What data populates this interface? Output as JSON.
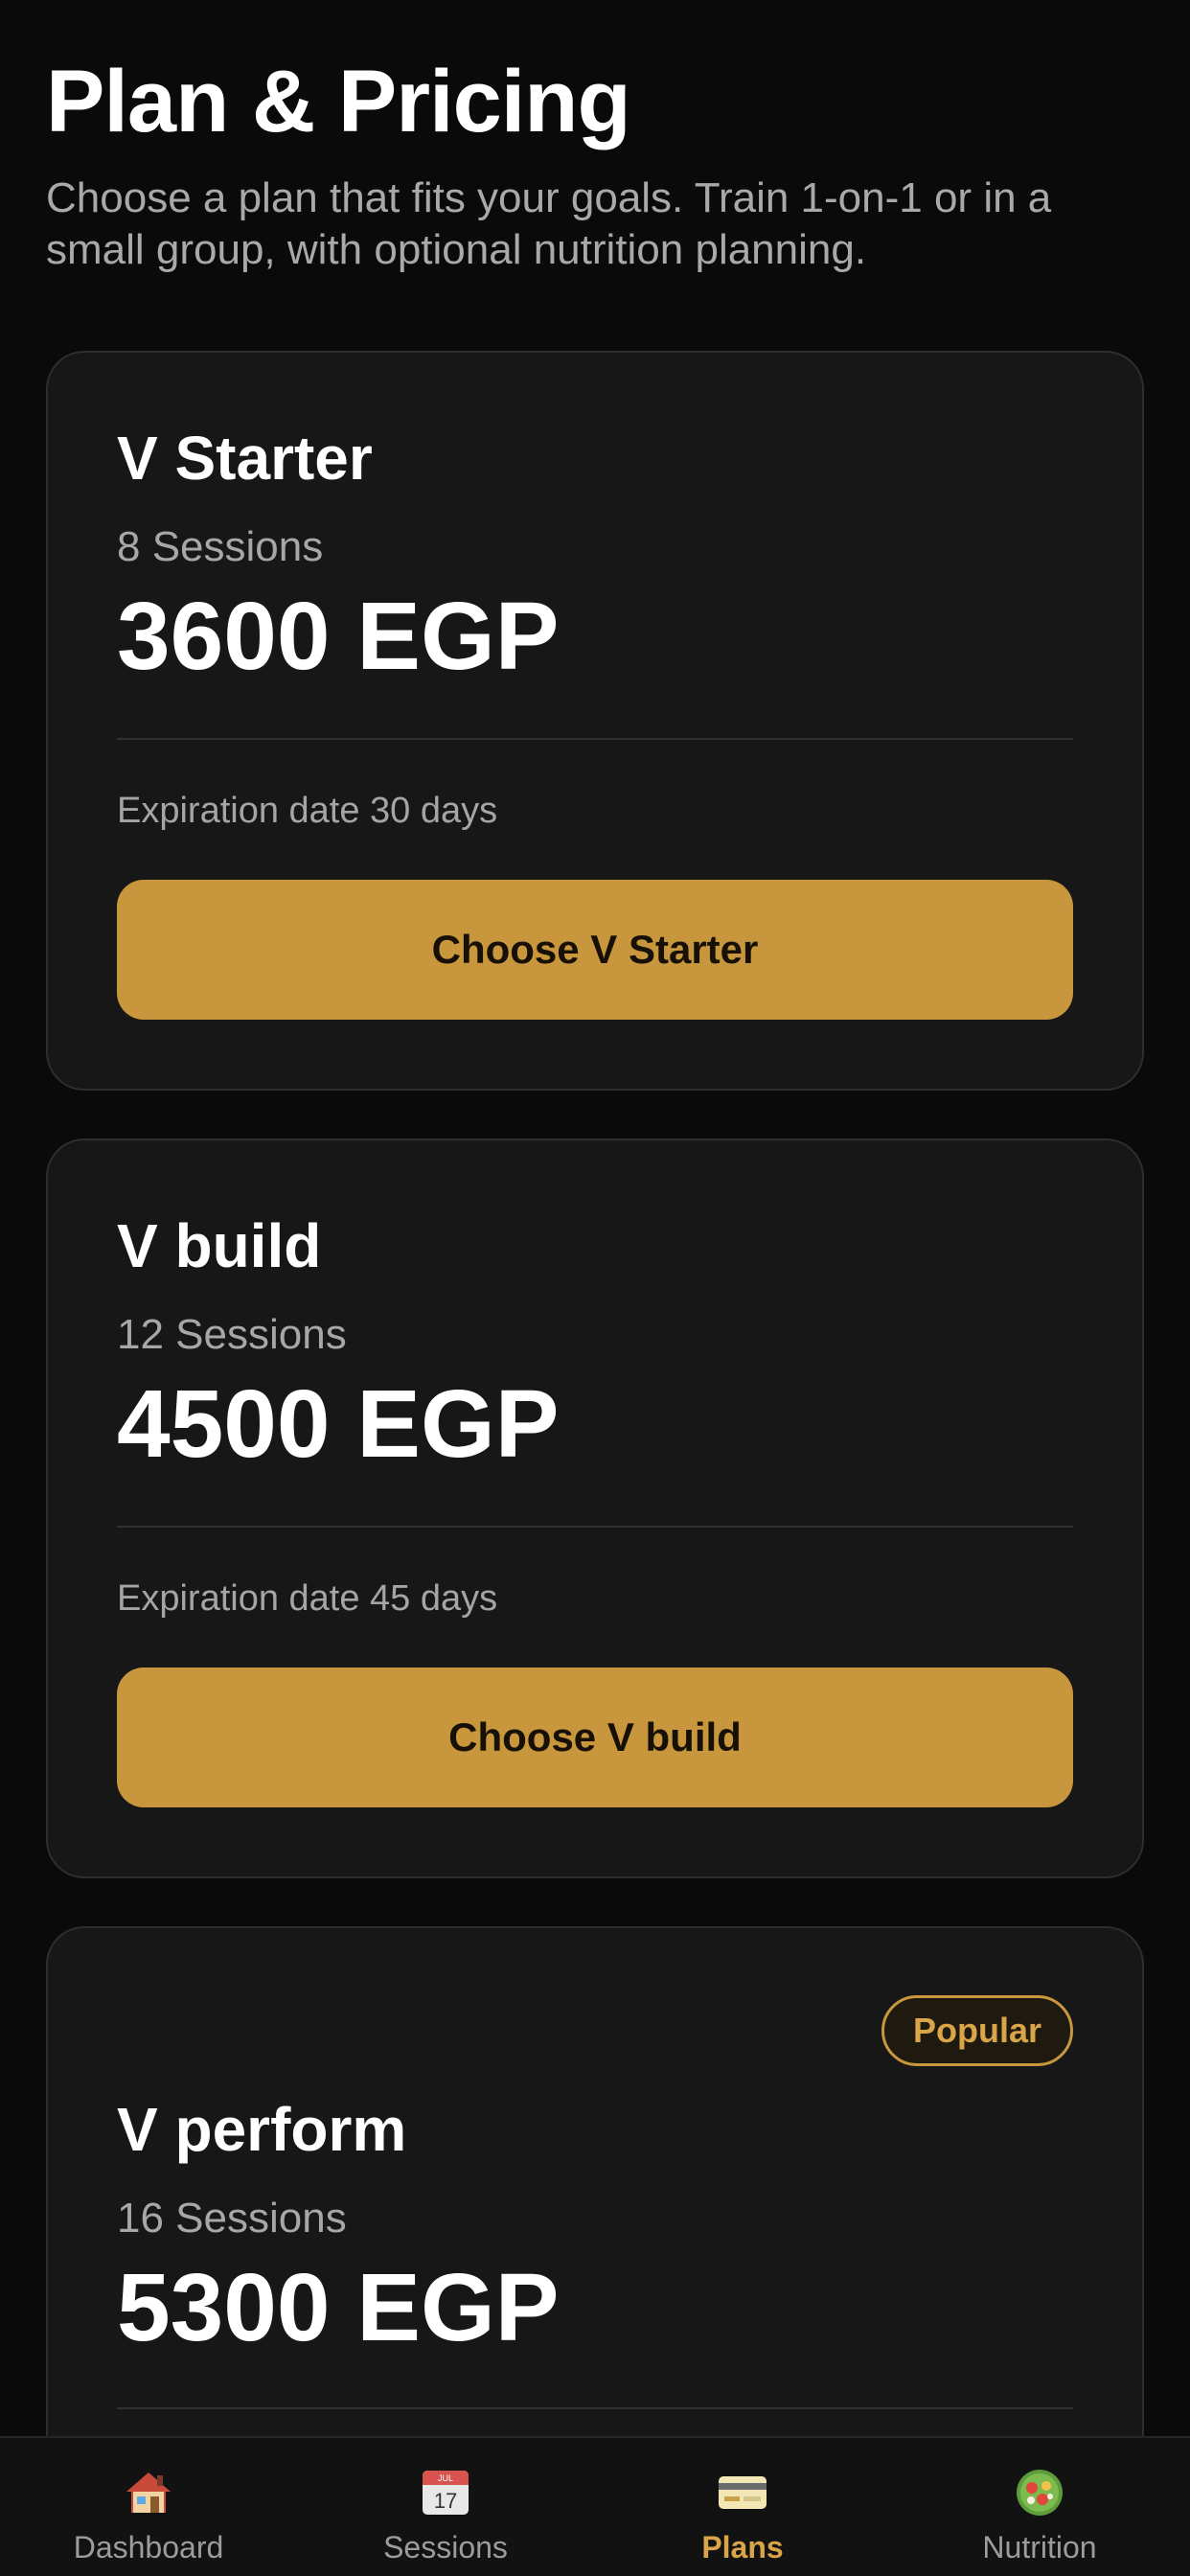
{
  "header": {
    "title": "Plan & Pricing",
    "subtitle": "Choose a plan that fits your goals. Train 1-on-1 or in a small group, with optional nutrition planning."
  },
  "plans": [
    {
      "name": "V Starter",
      "sessions": "8 Sessions",
      "price": "3600 EGP",
      "expiry": "Expiration date 30 days",
      "button_label": "Choose V Starter"
    },
    {
      "name": "V build",
      "sessions": "12 Sessions",
      "price": "4500 EGP",
      "expiry": "Expiration date 45 days",
      "button_label": "Choose V build"
    },
    {
      "name": "V perform",
      "sessions": "16 Sessions",
      "price": "5300 EGP",
      "badge": "Popular"
    }
  ],
  "tabbar": {
    "items": [
      {
        "label": "Dashboard",
        "icon": "house-icon"
      },
      {
        "label": "Sessions",
        "icon": "calendar-icon",
        "icon_text_month": "JUL",
        "icon_text_day": "17"
      },
      {
        "label": "Plans",
        "icon": "credit-card-icon",
        "active": true
      },
      {
        "label": "Nutrition",
        "icon": "salad-icon"
      }
    ]
  },
  "colors": {
    "accent": "#c8963c",
    "background": "#0a0a0a",
    "card": "#171717",
    "muted_text": "#a7a7a7"
  }
}
